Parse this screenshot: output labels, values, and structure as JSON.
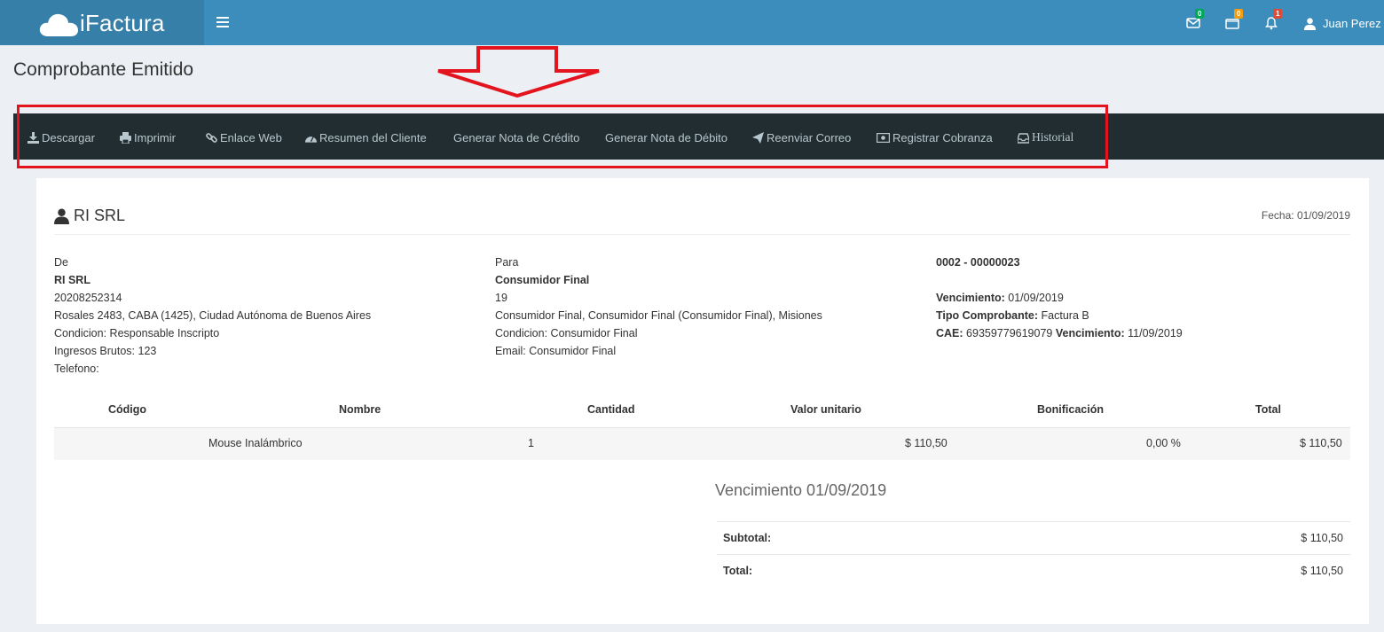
{
  "app": {
    "name": "iFactura",
    "user": "Juan Perez",
    "badges": {
      "mail": "0",
      "tasks": "0",
      "alerts": "1"
    }
  },
  "page": {
    "title": "Comprobante Emitido"
  },
  "toolbar": {
    "descargar": "Descargar",
    "imprimir": "Imprimir",
    "enlace_web": "Enlace Web",
    "resumen_cliente": "Resumen del Cliente",
    "nota_credito": "Generar Nota de Crédito",
    "nota_debito": "Generar Nota de Débito",
    "reenviar_correo": "Reenviar Correo",
    "registrar_cobranza": "Registrar Cobranza",
    "historial": "Historial"
  },
  "invoice": {
    "company": "RI SRL",
    "fecha": "Fecha: 01/09/2019",
    "from": {
      "label": "De",
      "name": "RI SRL",
      "cuit": "20208252314",
      "address": "Rosales 2483, CABA (1425), Ciudad Autónoma de Buenos Aires",
      "condicion": "Condicion: Responsable Inscripto",
      "ingresos": "Ingresos Brutos: 123",
      "telefono": "Telefono:"
    },
    "to": {
      "label": "Para",
      "name": "Consumidor Final",
      "doc": "19",
      "address": "Consumidor Final, Consumidor Final (Consumidor Final), Misiones",
      "condicion": "Condicion: Consumidor Final",
      "email": "Email: Consumidor Final"
    },
    "meta": {
      "numero": "0002 - 00000023",
      "venc_label": "Vencimiento:",
      "venc_value": " 01/09/2019",
      "tipo_label": "Tipo Comprobante:",
      "tipo_value": " Factura B",
      "cae_label": "CAE:",
      "cae_value": " 69359779619079 ",
      "cae_venc_label": "Vencimiento:",
      "cae_venc_value": " 11/09/2019"
    },
    "table": {
      "headers": [
        "Código",
        "Nombre",
        "Cantidad",
        "Valor unitario",
        "Bonificación",
        "Total"
      ],
      "rows": [
        {
          "codigo": "",
          "nombre": "Mouse Inalámbrico",
          "cantidad": "1",
          "valor": "$ 110,50",
          "bonificacion": "0,00 %",
          "total": "$ 110,50"
        }
      ]
    },
    "vencimiento_heading": "Vencimiento 01/09/2019",
    "subtotal_label": "Subtotal:",
    "subtotal_value": "$ 110,50",
    "total_label": "Total:",
    "total_value": "$ 110,50"
  }
}
